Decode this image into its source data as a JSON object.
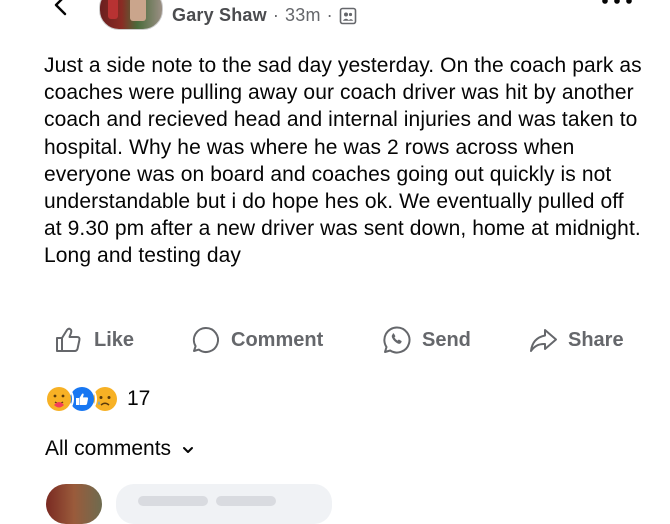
{
  "header": {
    "author_name": "Gary Shaw",
    "separator": "·",
    "time": "33m",
    "audience_icon": "group-audience-icon",
    "back_icon": "chevron-left-icon",
    "more_icon": "more-dots-icon"
  },
  "post": {
    "text": "Just a side note to the sad day yesterday. On the coach park as coaches were pulling away our coach driver was hit by another coach and recieved head and internal injuries and was taken to hospital. Why he was where he was 2 rows across when everyone was on board and coaches going out quickly is not understandable but i do hope hes ok. We eventually pulled off at 9.30 pm after a new driver was sent down, home at midnight. Long and testing day"
  },
  "actions": {
    "like": "Like",
    "comment": "Comment",
    "send": "Send",
    "share": "Share"
  },
  "reactions": {
    "icons": [
      "care-reaction-icon",
      "like-reaction-icon",
      "sad-reaction-icon"
    ],
    "count": "17"
  },
  "comments": {
    "sort_label": "All comments"
  },
  "colors": {
    "secondary_text": "#65676b",
    "primary_text": "#050505",
    "like_blue": "#1877f2",
    "reaction_yellow": "#f7b125",
    "bubble_bg": "#f0f2f5"
  }
}
